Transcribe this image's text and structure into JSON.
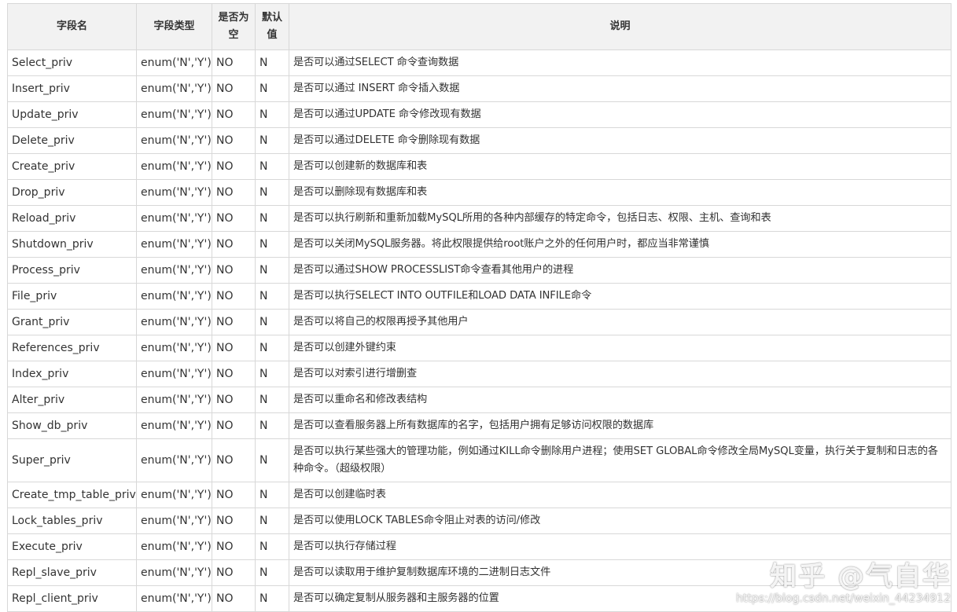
{
  "headers": {
    "name": "字段名",
    "type": "字段类型",
    "nullable": "是否为空",
    "default": "默认值",
    "description": "说明"
  },
  "rows": [
    {
      "name": "Select_priv",
      "type": "enum('N','Y')",
      "nullable": "NO",
      "default": "N",
      "description": "是否可以通过SELECT 命令查询数据"
    },
    {
      "name": "Insert_priv",
      "type": "enum('N','Y')",
      "nullable": "NO",
      "default": "N",
      "description": "是否可以通过 INSERT 命令插入数据"
    },
    {
      "name": "Update_priv",
      "type": "enum('N','Y')",
      "nullable": "NO",
      "default": "N",
      "description": "是否可以通过UPDATE 命令修改现有数据"
    },
    {
      "name": "Delete_priv",
      "type": "enum('N','Y')",
      "nullable": "NO",
      "default": "N",
      "description": "是否可以通过DELETE 命令删除现有数据"
    },
    {
      "name": "Create_priv",
      "type": "enum('N','Y')",
      "nullable": "NO",
      "default": "N",
      "description": "是否可以创建新的数据库和表"
    },
    {
      "name": "Drop_priv",
      "type": "enum('N','Y')",
      "nullable": "NO",
      "default": "N",
      "description": "是否可以删除现有数据库和表"
    },
    {
      "name": "Reload_priv",
      "type": "enum('N','Y')",
      "nullable": "NO",
      "default": "N",
      "description": "是否可以执行刷新和重新加载MySQL所用的各种内部缓存的特定命令，包括日志、权限、主机、查询和表"
    },
    {
      "name": "Shutdown_priv",
      "type": "enum('N','Y')",
      "nullable": "NO",
      "default": "N",
      "description": "是否可以关闭MySQL服务器。将此权限提供给root账户之外的任何用户时，都应当非常谨慎"
    },
    {
      "name": "Process_priv",
      "type": "enum('N','Y')",
      "nullable": "NO",
      "default": "N",
      "description": "是否可以通过SHOW PROCESSLIST命令查看其他用户的进程"
    },
    {
      "name": "File_priv",
      "type": "enum('N','Y')",
      "nullable": "NO",
      "default": "N",
      "description": "是否可以执行SELECT INTO OUTFILE和LOAD DATA INFILE命令"
    },
    {
      "name": "Grant_priv",
      "type": "enum('N','Y')",
      "nullable": "NO",
      "default": "N",
      "description": "是否可以将自己的权限再授予其他用户"
    },
    {
      "name": "References_priv",
      "type": "enum('N','Y')",
      "nullable": "NO",
      "default": "N",
      "description": "是否可以创建外键约束"
    },
    {
      "name": "Index_priv",
      "type": "enum('N','Y')",
      "nullable": "NO",
      "default": "N",
      "description": "是否可以对索引进行增删查"
    },
    {
      "name": "Alter_priv",
      "type": "enum('N','Y')",
      "nullable": "NO",
      "default": "N",
      "description": "是否可以重命名和修改表结构"
    },
    {
      "name": "Show_db_priv",
      "type": "enum('N','Y')",
      "nullable": "NO",
      "default": "N",
      "description": "是否可以查看服务器上所有数据库的名字，包括用户拥有足够访问权限的数据库"
    },
    {
      "name": "Super_priv",
      "type": "enum('N','Y')",
      "nullable": "NO",
      "default": "N",
      "description": "是否可以执行某些强大的管理功能，例如通过KILL命令删除用户进程；使用SET GLOBAL命令修改全局MySQL变量，执行关于复制和日志的各种命令。（超级权限）"
    },
    {
      "name": "Create_tmp_table_priv",
      "type": "enum('N','Y')",
      "nullable": "NO",
      "default": "N",
      "description": "是否可以创建临时表"
    },
    {
      "name": "Lock_tables_priv",
      "type": "enum('N','Y')",
      "nullable": "NO",
      "default": "N",
      "description": "是否可以使用LOCK TABLES命令阻止对表的访问/修改"
    },
    {
      "name": "Execute_priv",
      "type": "enum('N','Y')",
      "nullable": "NO",
      "default": "N",
      "description": "是否可以执行存储过程"
    },
    {
      "name": "Repl_slave_priv",
      "type": "enum('N','Y')",
      "nullable": "NO",
      "default": "N",
      "description": "是否可以读取用于维护复制数据库环境的二进制日志文件"
    },
    {
      "name": "Repl_client_priv",
      "type": "enum('N','Y')",
      "nullable": "NO",
      "default": "N",
      "description": "是否可以确定复制从服务器和主服务器的位置"
    }
  ],
  "watermark": {
    "brand": "知乎 @气自华",
    "url": "https://blog.csdn.net/weixin_44234912"
  }
}
